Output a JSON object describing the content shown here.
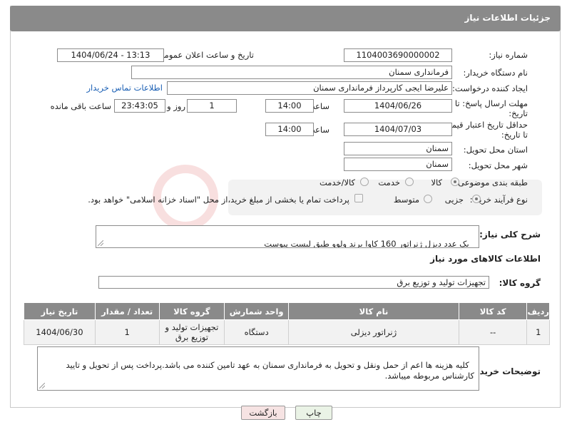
{
  "header": {
    "title": "جزئیات اطلاعات نیاز"
  },
  "form": {
    "need_number": {
      "label": "شماره نیاز:",
      "value": "1104003690000002"
    },
    "announce_datetime": {
      "label": "تاریخ و ساعت اعلان عمومی:",
      "value": "1404/06/24 - 13:13"
    },
    "buyer_org": {
      "label": "نام دستگاه خریدار:",
      "value": "فرمانداری سمنان"
    },
    "creator": {
      "label": "ایجاد کننده درخواست:",
      "value": "علیرضا ایجی کارپرداز فرمانداری سمنان",
      "contact_link": "اطلاعات تماس خریدار"
    },
    "reply_deadline": {
      "label_line1": "مهلت ارسال پاسخ: تا",
      "label_line2": "تاریخ:",
      "date": "1404/06/26",
      "time_label": "ساعت",
      "time": "14:00",
      "days": "1",
      "days_label": "روز و",
      "remaining": "23:43:05",
      "remaining_label": "ساعت باقی مانده"
    },
    "price_validity": {
      "label_line1": "حداقل تاریخ اعتبار قیمت:",
      "label_line2": "تا تاریخ:",
      "date": "1404/07/03",
      "time_label": "ساعت",
      "time": "14:00"
    },
    "delivery_province": {
      "label": "استان محل تحویل:",
      "value": "سمنان"
    },
    "delivery_city": {
      "label": "شهر محل تحویل:",
      "value": "سمنان"
    },
    "category": {
      "label": "طبقه بندی موضوعی:",
      "options": [
        "کالا",
        "خدمت",
        "کالا/خدمت"
      ],
      "selected": "کالا"
    },
    "purchase_type": {
      "label": "نوع فرآیند خرید :",
      "options": [
        "جزیی",
        "متوسط"
      ],
      "selected": "جزیی",
      "payment_note": "پرداخت تمام یا بخشی از مبلغ خرید،از محل \"اسناد خزانه اسلامی\" خواهد بود."
    },
    "description": {
      "label": "شرح کلی نیاز:",
      "value": "یک عدد دیزل ژنراتور 160 کاوا برند ولوو طبق لیست پیوست"
    }
  },
  "goods": {
    "section_title": "اطلاعات کالاهای مورد نیاز",
    "group_label": "گروه کالا:",
    "group_value": "تجهیزات تولید و توزیع برق",
    "columns": [
      "ردیف",
      "کد کالا",
      "نام کالا",
      "واحد شمارش",
      "گروه کالا",
      "تعداد / مقدار",
      "تاریخ نیاز"
    ],
    "rows": [
      {
        "row": "1",
        "code": "--",
        "name": "ژنراتور دیزلی",
        "unit": "دستگاه",
        "group": "تجهیزات تولید و توزیع برق",
        "qty": "1",
        "date": "1404/06/30"
      }
    ]
  },
  "buyer_notes": {
    "label": "توضیحات خریدار:",
    "value": "کلیه هزینه ها اعم از حمل ونقل و تحویل به فرمانداری سمنان به عهد تامین کننده می باشد.پرداخت پس از تحویل و تایید کارشناس مربوطه میباشد."
  },
  "buttons": {
    "print": "چاپ",
    "back": "بازگشت"
  },
  "colors": {
    "header_bg": "#8a8a8a",
    "link": "#1a5fb4",
    "print_bg": "#eaf3e6",
    "back_bg": "#f6e3e3"
  }
}
